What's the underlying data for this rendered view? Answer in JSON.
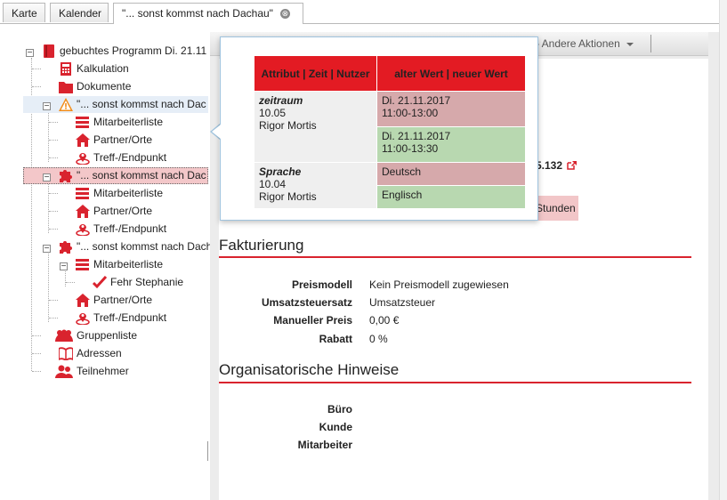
{
  "tabs": [
    {
      "label": "Karte"
    },
    {
      "label": "Kalender"
    },
    {
      "label": "\"... sonst kommst nach Dachau\"",
      "close": "⊗"
    }
  ],
  "tree": {
    "root": "gebuchtes Programm Di. 21.11",
    "items": [
      {
        "label": "Kalkulation",
        "icon": "calculator-icon"
      },
      {
        "label": "Dokumente",
        "icon": "folder-icon"
      },
      {
        "label": "\"... sonst kommst nach Dac",
        "icon": "warning-icon"
      },
      {
        "label": "Mitarbeiterliste",
        "icon": "list-icon"
      },
      {
        "label": "Partner/Orte",
        "icon": "house-icon"
      },
      {
        "label": "Treff-/Endpunkt",
        "icon": "location-pin-icon"
      },
      {
        "label": "\"... sonst kommst nach Dac",
        "icon": "puzzle-icon"
      },
      {
        "label": "Mitarbeiterliste",
        "icon": "list-icon"
      },
      {
        "label": "Partner/Orte",
        "icon": "house-icon"
      },
      {
        "label": "Treff-/Endpunkt",
        "icon": "location-pin-icon"
      },
      {
        "label": "\"... sonst kommst nach Dachau\"",
        "icon": "puzzle-icon"
      },
      {
        "label": "Mitarbeiterliste",
        "icon": "list-icon"
      },
      {
        "label": "Fehr Stephanie",
        "icon": "checkmark-icon"
      },
      {
        "label": "Partner/Orte",
        "icon": "house-icon"
      },
      {
        "label": "Treff-/Endpunkt",
        "icon": "location-pin-icon"
      },
      {
        "label": "Gruppenliste",
        "icon": "group-icon"
      },
      {
        "label": "Adressen",
        "icon": "book-icon"
      },
      {
        "label": "Teilnehmer",
        "icon": "participants-icon"
      }
    ]
  },
  "toolbar": {
    "other_actions": "Andere Aktionen"
  },
  "peek": {
    "number": "5.132",
    "stunden": "Stunden"
  },
  "fakturierung": {
    "title": "Fakturierung",
    "fields": [
      {
        "label": "Preismodell",
        "value": "Kein Preismodell zugewiesen"
      },
      {
        "label": "Umsatzsteuersatz",
        "value": "Umsatzsteuer"
      },
      {
        "label": "Manueller Preis",
        "value": "0,00 €"
      },
      {
        "label": "Rabatt",
        "value": "0 %"
      }
    ]
  },
  "hinweise": {
    "title": "Organisatorische Hinweise",
    "fields": [
      {
        "label": "Büro"
      },
      {
        "label": "Kunde"
      },
      {
        "label": "Mitarbeiter"
      }
    ]
  },
  "history": {
    "col1": "Attribut | Zeit | Nutzer",
    "col2": "alter Wert | neuer Wert",
    "rows": [
      {
        "attr": "zeitraum",
        "time": "10.05",
        "user": "Rigor Mortis",
        "old1": "Di. 21.11.2017",
        "old2": "11:00-13:00",
        "new1": "Di. 21.11.2017",
        "new2": "11:00-13:30"
      },
      {
        "attr": "Sprache",
        "time": "10.04",
        "user": "Rigor Mortis",
        "old1": "Deutsch",
        "new1": "Englisch"
      }
    ]
  },
  "colors": {
    "accent": "#d9232e",
    "old": "#d6a9ab",
    "new": "#b8d8b0"
  }
}
